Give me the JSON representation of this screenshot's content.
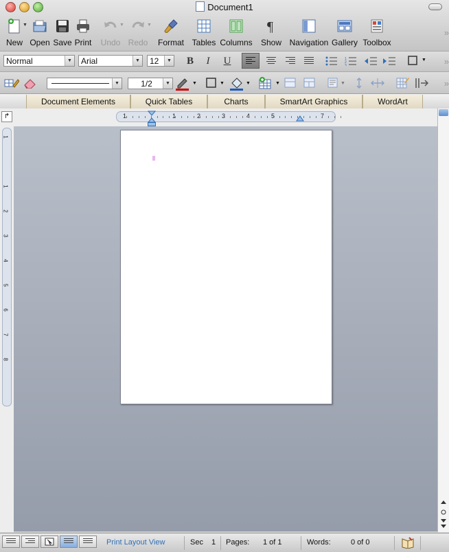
{
  "window": {
    "title": "Document1"
  },
  "toolbar": {
    "buttons": [
      {
        "label": "New",
        "icon": "new-document-icon"
      },
      {
        "label": "Open",
        "icon": "open-folder-icon"
      },
      {
        "label": "Save",
        "icon": "floppy-disk-icon"
      },
      {
        "label": "Print",
        "icon": "printer-icon"
      },
      {
        "label": "Undo",
        "icon": "undo-icon"
      },
      {
        "label": "Redo",
        "icon": "redo-icon"
      },
      {
        "label": "Format",
        "icon": "paintbrush-icon"
      },
      {
        "label": "Tables",
        "icon": "table-icon"
      },
      {
        "label": "Columns",
        "icon": "columns-icon"
      },
      {
        "label": "Show",
        "icon": "pilcrow-icon"
      },
      {
        "label": "Navigation",
        "icon": "navigation-pane-icon"
      },
      {
        "label": "Gallery",
        "icon": "gallery-icon"
      },
      {
        "label": "Toolbox",
        "icon": "toolbox-icon"
      }
    ],
    "overflow": "»"
  },
  "formatting": {
    "style": "Normal",
    "font": "Arial",
    "size": "12",
    "bold": "B",
    "italic": "I",
    "underline": "U"
  },
  "drawing": {
    "line_weight": "1/2"
  },
  "gallery_tabs": [
    "Document Elements",
    "Quick Tables",
    "Charts",
    "SmartArt Graphics",
    "WordArt"
  ],
  "ruler": {
    "horizontal_numbers": [
      "1",
      "1",
      "2",
      "3",
      "4",
      "5",
      "7"
    ],
    "vertical_numbers": [
      "1",
      "1",
      "2",
      "3",
      "4",
      "5",
      "6",
      "7",
      "8"
    ]
  },
  "status": {
    "view": "Print Layout View",
    "sec_label": "Sec",
    "sec_value": "1",
    "pages_label": "Pages:",
    "pages_value": "1 of 1",
    "words_label": "Words:",
    "words_value": "0 of 0"
  },
  "colors": {
    "accent_blue": "#2f6fb8",
    "workspace_top": "#b9bfc9",
    "workspace_bottom": "#959caa",
    "close": "#e0443e",
    "minimize": "#dea123",
    "zoom": "#5fb33f",
    "font_color_swatch": "#cc0000"
  }
}
